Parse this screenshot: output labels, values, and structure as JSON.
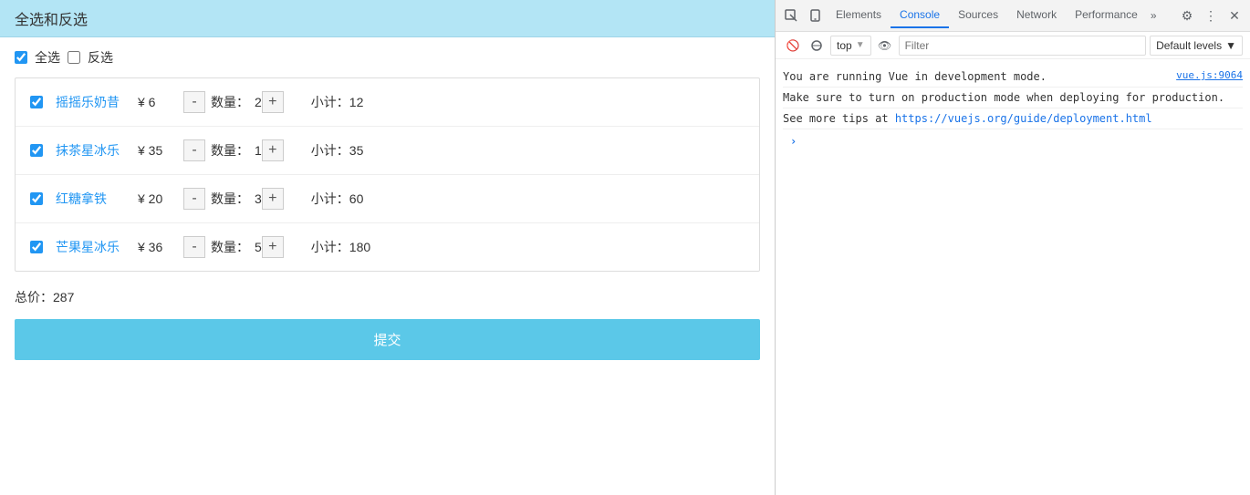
{
  "app": {
    "title": "全选和反选",
    "select_all_label": "全选",
    "invert_label": "反选",
    "items": [
      {
        "id": 1,
        "name": "摇摇乐奶昔",
        "price": "¥ 6",
        "quantity": 2,
        "subtotal": 12,
        "checked": true
      },
      {
        "id": 2,
        "name": "抹茶星冰乐",
        "price": "¥ 35",
        "quantity": 1,
        "subtotal": 35,
        "checked": true
      },
      {
        "id": 3,
        "name": "红糖拿铁",
        "price": "¥ 20",
        "quantity": 3,
        "subtotal": 60,
        "checked": true
      },
      {
        "id": 4,
        "name": "芒果星冰乐",
        "price": "¥ 36",
        "quantity": 5,
        "subtotal": 180,
        "checked": true
      }
    ],
    "total_label": "总价：",
    "total_value": "287",
    "submit_label": "提交",
    "qty_label": "数量："
  },
  "devtools": {
    "tabs": [
      "Elements",
      "Console",
      "Sources",
      "Network",
      "Performance"
    ],
    "active_tab": "Console",
    "more_label": "»",
    "toolbar": {
      "context": "top",
      "filter_placeholder": "Filter",
      "levels_label": "Default levels"
    },
    "console_messages": [
      {
        "text": "You are running Vue in development mode.",
        "source": "vue.js:9064",
        "link": null
      },
      {
        "text": "Make sure to turn on production mode when deploying for production.",
        "source": null,
        "link": null
      },
      {
        "text": "See more tips at ",
        "link_text": "https://vuejs.org/guide/deployment.html",
        "source": null
      }
    ]
  }
}
